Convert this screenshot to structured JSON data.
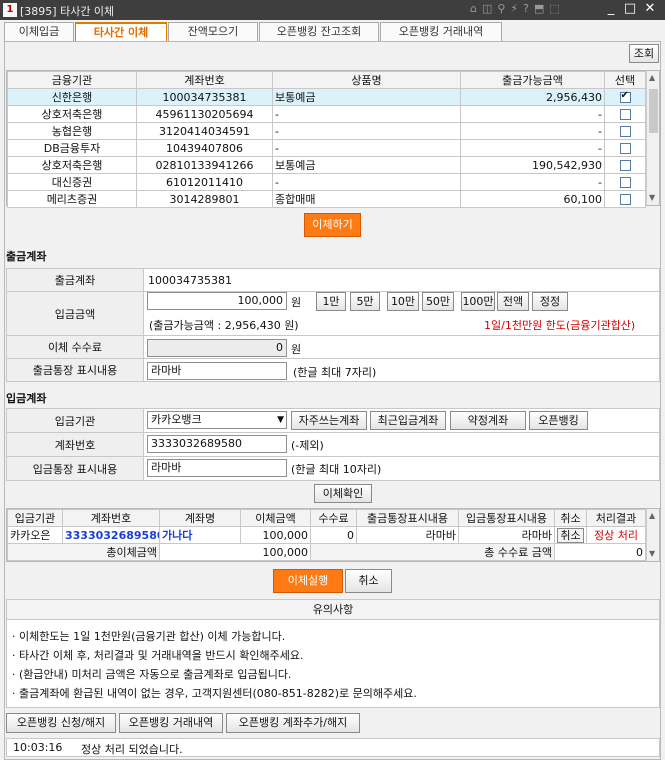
{
  "window": {
    "title": "[3895] 타사간 이체",
    "app_badge": "1"
  },
  "tabs": [
    "이체입금",
    "타사간 이체",
    "잔액모으기",
    "오픈뱅킹 잔고조회",
    "오픈뱅킹 거래내역"
  ],
  "query_button": "조회",
  "accounts_table": {
    "headers": [
      "금융기관",
      "계좌번호",
      "상품명",
      "출금가능금액",
      "선택"
    ],
    "rows": [
      {
        "inst": "신한은행",
        "acct": "100034735381",
        "product": "보통예금",
        "amount": "2,956,430",
        "checked": true
      },
      {
        "inst": "상호저축은행",
        "acct": "45961130205694",
        "product": "-",
        "amount": "-",
        "checked": false
      },
      {
        "inst": "농협은행",
        "acct": "3120414034591",
        "product": "-",
        "amount": "-",
        "checked": false
      },
      {
        "inst": "DB금융투자",
        "acct": "10439407806",
        "product": "-",
        "amount": "-",
        "checked": false
      },
      {
        "inst": "상호저축은행",
        "acct": "02810133941266",
        "product": "보통예금",
        "amount": "190,542,930",
        "checked": false
      },
      {
        "inst": "대신증권",
        "acct": "61012011410",
        "product": "-",
        "amount": "-",
        "checked": false
      },
      {
        "inst": "메리츠증권",
        "acct": "3014289801",
        "product": "종합매매",
        "amount": "60,100",
        "checked": false
      }
    ]
  },
  "transfer_button": "이체하기",
  "withdraw_section": {
    "title": "출금계좌",
    "account_label": "출금계좌",
    "account_value": "100034735381",
    "amount_label": "입금금액",
    "amount_value": "100,000",
    "amount_unit": "원",
    "quick_buttons": [
      "1만",
      "5만",
      "10만",
      "50만",
      "100만",
      "전액",
      "정정"
    ],
    "available_note": "(출금가능금액 : 2,956,430 원)",
    "limit_note": "1일/1천만원 한도(금융기관합산)",
    "fee_label": "이체 수수료",
    "fee_value": "0",
    "fee_unit": "원",
    "memo_label": "출금통장 표시내용",
    "memo_value": "라마바",
    "memo_hint": "(한글 최대 7자리)"
  },
  "deposit_section": {
    "title": "입금계좌",
    "inst_label": "입금기관",
    "inst_value": "카카오뱅크",
    "inst_buttons": [
      "자주쓰는계좌",
      "최근입금계좌",
      "약정계좌",
      "오픈뱅킹"
    ],
    "acct_label": "계좌번호",
    "acct_value": "3333032689580",
    "acct_hint": "(-제외)",
    "memo_label": "입금통장 표시내용",
    "memo_value": "라마바",
    "memo_hint": "(한글 최대 10자리)"
  },
  "confirm_button": "이체확인",
  "transfer_table": {
    "headers": [
      "입금기관",
      "계좌번호",
      "계좌명",
      "이체금액",
      "수수료",
      "출금통장표시내용",
      "입금통장표시내용",
      "취소",
      "처리결과"
    ],
    "row": {
      "inst": "카카오은",
      "acct": "3333032689580",
      "name": "가나다",
      "amount": "100,000",
      "fee": "0",
      "out_memo": "라마바",
      "in_memo": "라마바",
      "cancel": "취소",
      "result": "정상 처리"
    },
    "total_label": "총이체금액",
    "total_value": "100,000",
    "total_fee_label": "총 수수료 금액",
    "total_fee_value": "0"
  },
  "execute_button": "이체실행",
  "cancel_button": "취소",
  "notice": {
    "title": "유의사항",
    "lines": [
      "· 이체한도는 1일 1천만원(금융기관 합산) 이체 가능합니다.",
      "· 타사간 이체 후, 처리결과 및 거래내역을 반드시 확인해주세요.",
      "· (환급안내) 미처리 금액은 자동으로 출금계좌로 입금됩니다.",
      "· 출금계좌에 환급된 내역이 없는 경우, 고객지원센터(080-851-8282)로 문의해주세요."
    ]
  },
  "bottom_buttons": [
    "오픈뱅킹 신청/해지",
    "오픈뱅킹 거래내역",
    "오픈뱅킹 계좌추가/해지"
  ],
  "status": {
    "time": "10:03:16",
    "message": "정상 처리 되었습니다."
  }
}
